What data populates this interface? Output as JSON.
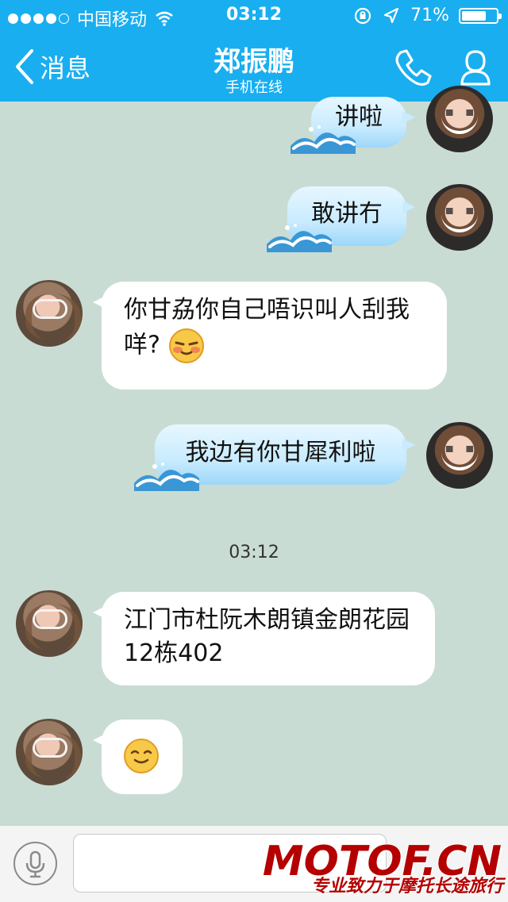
{
  "status_bar": {
    "carrier": "中国移动",
    "time": "03:12",
    "battery": "71%",
    "battery_level": 0.71
  },
  "header": {
    "back_label": "消息",
    "title": "郑振鹏",
    "subtitle": "手机在线"
  },
  "messages": [
    {
      "side": "out",
      "text": "讲啦"
    },
    {
      "side": "out",
      "text": "敢讲冇"
    },
    {
      "side": "in",
      "text": "你甘劦你自己唔识叫人刮我咩?",
      "emoji": "blush-emoji"
    },
    {
      "side": "out",
      "text": "我边有你甘犀利啦"
    },
    {
      "side": "in",
      "text": "江门市杜阮木朗镇金朗花园12栋402"
    },
    {
      "side": "in",
      "text": "",
      "emoji": "smile-emoji"
    }
  ],
  "timestamp": "03:12",
  "input": {
    "value": "",
    "placeholder": ""
  },
  "watermark": {
    "main": "MOTOF.CN",
    "sub": "专业致力于摩托长途旅行"
  },
  "icons": {
    "back": "chevron-left-icon",
    "call": "phone-icon",
    "profile": "user-icon",
    "voice": "microphone-icon",
    "wave": "wave-icon",
    "wifi": "wifi-icon",
    "location": "location-arrow-icon",
    "lock": "rotation-lock-icon"
  },
  "colors": {
    "header": "#19aef0",
    "chat_background": "#c9dcd4",
    "outgoing_bubble": "#c8ebff",
    "incoming_bubble": "#ffffff",
    "watermark": "#b40000"
  }
}
